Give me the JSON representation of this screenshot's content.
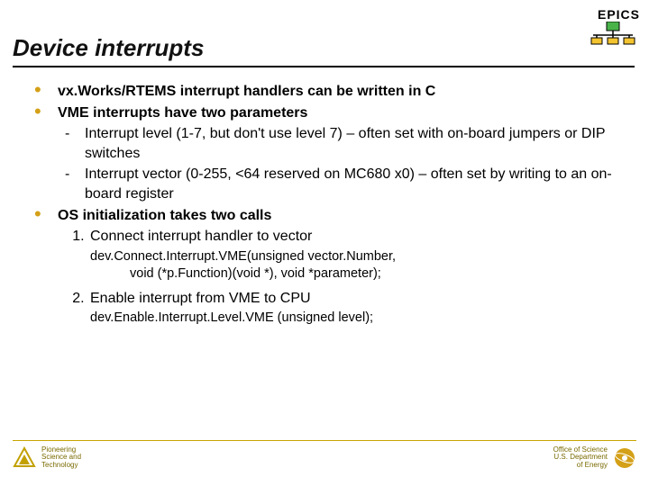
{
  "brand": {
    "name": "EPICS"
  },
  "title": "Device interrupts",
  "bullets": {
    "b1": "vx.Works/RTEMS interrupt handlers can be written in C",
    "b2": "VME interrupts have two parameters",
    "b2s1": "Interrupt level (1-7, but don't use level 7) – often set with on-board jumpers or DIP switches",
    "b2s2": "Interrupt vector (0-255, <64 reserved on MC680 x0) – often set by writing to an on-board register",
    "b3": "OS initialization takes two calls",
    "b3s1": "Connect interrupt handler to vector",
    "b3s1_code_l1": "dev.Connect.Interrupt.VME(unsigned vector.Number,",
    "b3s1_code_l2": "void (*p.Function)(void *), void *parameter);",
    "b3s2": "Enable interrupt from VME to CPU",
    "b3s2_code": "dev.Enable.Interrupt.Level.VME (unsigned level);"
  },
  "footer": {
    "left_l1": "Pioneering",
    "left_l2": "Science and",
    "left_l3": "Technology",
    "right_l1": "Office of Science",
    "right_l2": "U.S. Department",
    "right_l3": "of Energy"
  }
}
